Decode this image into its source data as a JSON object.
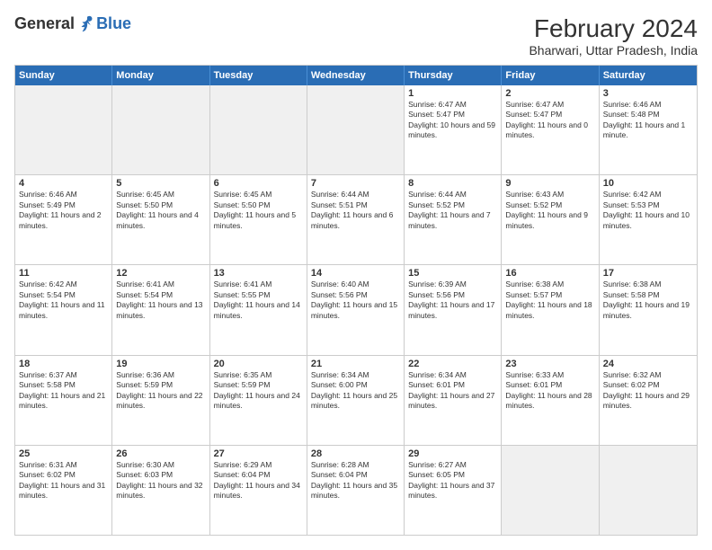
{
  "header": {
    "logo_line1": "General",
    "logo_line2": "Blue",
    "main_title": "February 2024",
    "subtitle": "Bharwari, Uttar Pradesh, India"
  },
  "days_of_week": [
    "Sunday",
    "Monday",
    "Tuesday",
    "Wednesday",
    "Thursday",
    "Friday",
    "Saturday"
  ],
  "rows": [
    [
      {
        "day": "",
        "info": "",
        "shaded": true
      },
      {
        "day": "",
        "info": "",
        "shaded": true
      },
      {
        "day": "",
        "info": "",
        "shaded": true
      },
      {
        "day": "",
        "info": "",
        "shaded": true
      },
      {
        "day": "1",
        "info": "Sunrise: 6:47 AM\nSunset: 5:47 PM\nDaylight: 10 hours and 59 minutes.",
        "shaded": false
      },
      {
        "day": "2",
        "info": "Sunrise: 6:47 AM\nSunset: 5:47 PM\nDaylight: 11 hours and 0 minutes.",
        "shaded": false
      },
      {
        "day": "3",
        "info": "Sunrise: 6:46 AM\nSunset: 5:48 PM\nDaylight: 11 hours and 1 minute.",
        "shaded": false
      }
    ],
    [
      {
        "day": "4",
        "info": "Sunrise: 6:46 AM\nSunset: 5:49 PM\nDaylight: 11 hours and 2 minutes.",
        "shaded": false
      },
      {
        "day": "5",
        "info": "Sunrise: 6:45 AM\nSunset: 5:50 PM\nDaylight: 11 hours and 4 minutes.",
        "shaded": false
      },
      {
        "day": "6",
        "info": "Sunrise: 6:45 AM\nSunset: 5:50 PM\nDaylight: 11 hours and 5 minutes.",
        "shaded": false
      },
      {
        "day": "7",
        "info": "Sunrise: 6:44 AM\nSunset: 5:51 PM\nDaylight: 11 hours and 6 minutes.",
        "shaded": false
      },
      {
        "day": "8",
        "info": "Sunrise: 6:44 AM\nSunset: 5:52 PM\nDaylight: 11 hours and 7 minutes.",
        "shaded": false
      },
      {
        "day": "9",
        "info": "Sunrise: 6:43 AM\nSunset: 5:52 PM\nDaylight: 11 hours and 9 minutes.",
        "shaded": false
      },
      {
        "day": "10",
        "info": "Sunrise: 6:42 AM\nSunset: 5:53 PM\nDaylight: 11 hours and 10 minutes.",
        "shaded": false
      }
    ],
    [
      {
        "day": "11",
        "info": "Sunrise: 6:42 AM\nSunset: 5:54 PM\nDaylight: 11 hours and 11 minutes.",
        "shaded": false
      },
      {
        "day": "12",
        "info": "Sunrise: 6:41 AM\nSunset: 5:54 PM\nDaylight: 11 hours and 13 minutes.",
        "shaded": false
      },
      {
        "day": "13",
        "info": "Sunrise: 6:41 AM\nSunset: 5:55 PM\nDaylight: 11 hours and 14 minutes.",
        "shaded": false
      },
      {
        "day": "14",
        "info": "Sunrise: 6:40 AM\nSunset: 5:56 PM\nDaylight: 11 hours and 15 minutes.",
        "shaded": false
      },
      {
        "day": "15",
        "info": "Sunrise: 6:39 AM\nSunset: 5:56 PM\nDaylight: 11 hours and 17 minutes.",
        "shaded": false
      },
      {
        "day": "16",
        "info": "Sunrise: 6:38 AM\nSunset: 5:57 PM\nDaylight: 11 hours and 18 minutes.",
        "shaded": false
      },
      {
        "day": "17",
        "info": "Sunrise: 6:38 AM\nSunset: 5:58 PM\nDaylight: 11 hours and 19 minutes.",
        "shaded": false
      }
    ],
    [
      {
        "day": "18",
        "info": "Sunrise: 6:37 AM\nSunset: 5:58 PM\nDaylight: 11 hours and 21 minutes.",
        "shaded": false
      },
      {
        "day": "19",
        "info": "Sunrise: 6:36 AM\nSunset: 5:59 PM\nDaylight: 11 hours and 22 minutes.",
        "shaded": false
      },
      {
        "day": "20",
        "info": "Sunrise: 6:35 AM\nSunset: 5:59 PM\nDaylight: 11 hours and 24 minutes.",
        "shaded": false
      },
      {
        "day": "21",
        "info": "Sunrise: 6:34 AM\nSunset: 6:00 PM\nDaylight: 11 hours and 25 minutes.",
        "shaded": false
      },
      {
        "day": "22",
        "info": "Sunrise: 6:34 AM\nSunset: 6:01 PM\nDaylight: 11 hours and 27 minutes.",
        "shaded": false
      },
      {
        "day": "23",
        "info": "Sunrise: 6:33 AM\nSunset: 6:01 PM\nDaylight: 11 hours and 28 minutes.",
        "shaded": false
      },
      {
        "day": "24",
        "info": "Sunrise: 6:32 AM\nSunset: 6:02 PM\nDaylight: 11 hours and 29 minutes.",
        "shaded": false
      }
    ],
    [
      {
        "day": "25",
        "info": "Sunrise: 6:31 AM\nSunset: 6:02 PM\nDaylight: 11 hours and 31 minutes.",
        "shaded": false
      },
      {
        "day": "26",
        "info": "Sunrise: 6:30 AM\nSunset: 6:03 PM\nDaylight: 11 hours and 32 minutes.",
        "shaded": false
      },
      {
        "day": "27",
        "info": "Sunrise: 6:29 AM\nSunset: 6:04 PM\nDaylight: 11 hours and 34 minutes.",
        "shaded": false
      },
      {
        "day": "28",
        "info": "Sunrise: 6:28 AM\nSunset: 6:04 PM\nDaylight: 11 hours and 35 minutes.",
        "shaded": false
      },
      {
        "day": "29",
        "info": "Sunrise: 6:27 AM\nSunset: 6:05 PM\nDaylight: 11 hours and 37 minutes.",
        "shaded": false
      },
      {
        "day": "",
        "info": "",
        "shaded": true
      },
      {
        "day": "",
        "info": "",
        "shaded": true
      }
    ]
  ]
}
